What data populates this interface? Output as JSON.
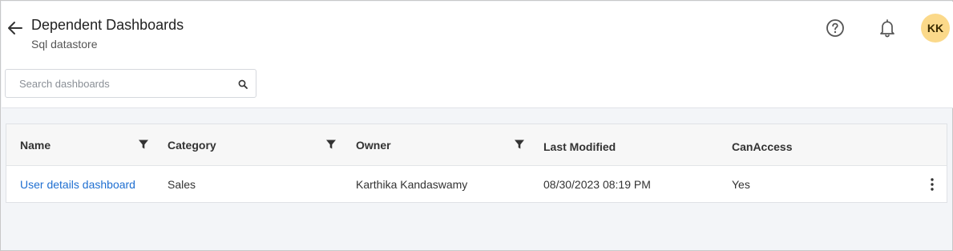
{
  "header": {
    "title": "Dependent Dashboards",
    "subtitle": "Sql datastore",
    "avatar_initials": "KK"
  },
  "search": {
    "placeholder": "Search dashboards",
    "value": ""
  },
  "table": {
    "columns": [
      {
        "label": "Name",
        "filterable": true
      },
      {
        "label": "Category",
        "filterable": true
      },
      {
        "label": "Owner",
        "filterable": true
      },
      {
        "label": "Last Modified",
        "filterable": false
      },
      {
        "label": "CanAccess",
        "filterable": false
      }
    ],
    "rows": [
      {
        "name": "User details dashboard",
        "category": "Sales",
        "owner": "Karthika Kandaswamy",
        "last_modified": "08/30/2023 08:19 PM",
        "can_access": "Yes"
      }
    ]
  },
  "icons": {
    "back": "arrow-left-icon",
    "help": "help-circle-icon",
    "notifications": "bell-icon",
    "search": "search-icon",
    "filter": "filter-icon",
    "more": "more-vertical-icon"
  },
  "colors": {
    "link": "#1f6fd1",
    "avatar_bg": "#fbd98a",
    "page_bg": "#f3f5f8"
  }
}
